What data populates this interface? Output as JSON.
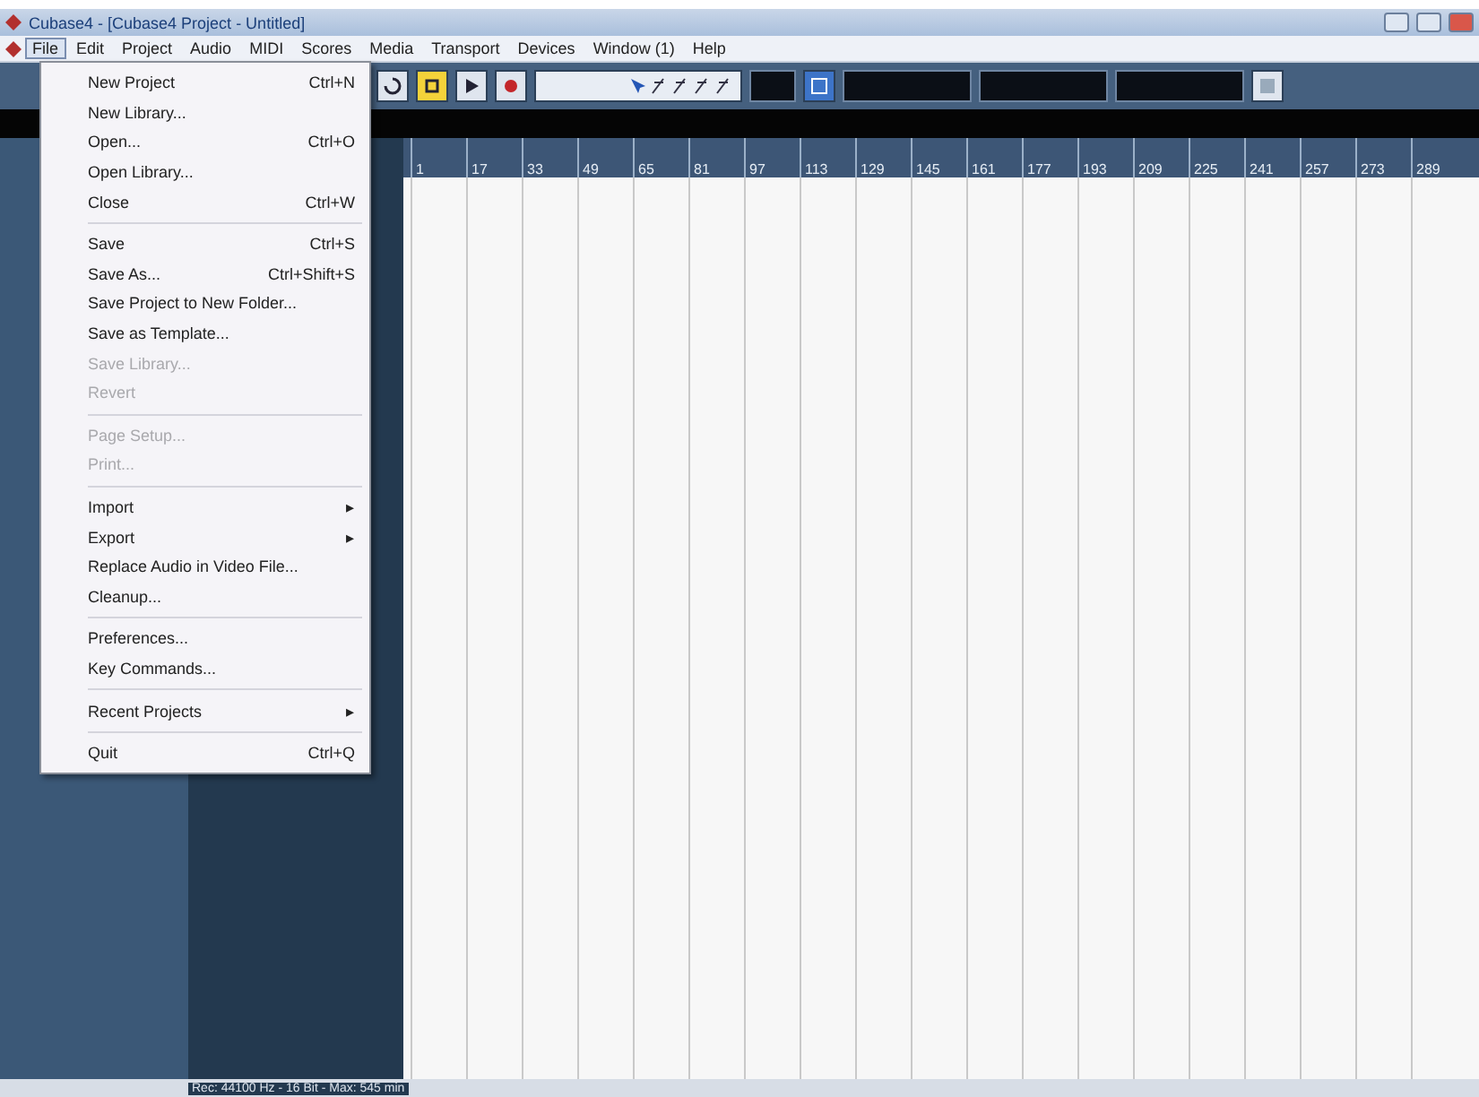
{
  "window": {
    "title": "Cubase4 - [Cubase4 Project - Untitled]"
  },
  "menu_bar": [
    {
      "label": "File",
      "selected": true
    },
    {
      "label": "Edit",
      "selected": false
    },
    {
      "label": "Project",
      "selected": false
    },
    {
      "label": "Audio",
      "selected": false
    },
    {
      "label": "MIDI",
      "selected": false
    },
    {
      "label": "Scores",
      "selected": false
    },
    {
      "label": "Media",
      "selected": false
    },
    {
      "label": "Transport",
      "selected": false
    },
    {
      "label": "Devices",
      "selected": false
    },
    {
      "label": "Window (1)",
      "selected": false
    },
    {
      "label": "Help",
      "selected": false
    }
  ],
  "file_menu": [
    {
      "kind": "item",
      "label": "New Project",
      "shortcut": "Ctrl+N",
      "disabled": false
    },
    {
      "kind": "item",
      "label": "New Library...",
      "disabled": false
    },
    {
      "kind": "item",
      "label": "Open...",
      "shortcut": "Ctrl+O",
      "disabled": false
    },
    {
      "kind": "item",
      "label": "Open Library...",
      "disabled": false
    },
    {
      "kind": "item",
      "label": "Close",
      "shortcut": "Ctrl+W",
      "disabled": false
    },
    {
      "kind": "separator"
    },
    {
      "kind": "item",
      "label": "Save",
      "shortcut": "Ctrl+S",
      "disabled": false
    },
    {
      "kind": "item",
      "label": "Save As...",
      "shortcut": "Ctrl+Shift+S",
      "disabled": false
    },
    {
      "kind": "item",
      "label": "Save Project to New Folder...",
      "disabled": false
    },
    {
      "kind": "item",
      "label": "Save as Template...",
      "disabled": false
    },
    {
      "kind": "item",
      "label": "Save Library...",
      "disabled": true
    },
    {
      "kind": "item",
      "label": "Revert",
      "disabled": true
    },
    {
      "kind": "separator"
    },
    {
      "kind": "item",
      "label": "Page Setup...",
      "disabled": true
    },
    {
      "kind": "item",
      "label": "Print...",
      "disabled": true
    },
    {
      "kind": "separator"
    },
    {
      "kind": "submenu",
      "label": "Import",
      "arrow": "▸",
      "disabled": false
    },
    {
      "kind": "submenu",
      "label": "Export",
      "arrow": "▸",
      "disabled": false
    },
    {
      "kind": "item",
      "label": "Replace Audio in Video File...",
      "disabled": false
    },
    {
      "kind": "item",
      "label": "Cleanup...",
      "disabled": false
    },
    {
      "kind": "separator"
    },
    {
      "kind": "item",
      "label": "Preferences...",
      "disabled": false
    },
    {
      "kind": "item",
      "label": "Key Commands...",
      "disabled": false
    },
    {
      "kind": "separator"
    },
    {
      "kind": "submenu",
      "label": "Recent Projects",
      "arrow": "▸",
      "disabled": false
    },
    {
      "kind": "separator"
    },
    {
      "kind": "item",
      "label": "Quit",
      "shortcut": "Ctrl+Q",
      "disabled": false
    }
  ],
  "ruler": {
    "labels": [
      "1",
      "17",
      "33",
      "49",
      "65",
      "81",
      "97",
      "113",
      "129",
      "145",
      "161",
      "177",
      "193",
      "209",
      "225",
      "241",
      "257",
      "273",
      "289"
    ]
  },
  "status_bar": {
    "text": "Rec: 44100 Hz - 16 Bit - Max: 545 min"
  }
}
